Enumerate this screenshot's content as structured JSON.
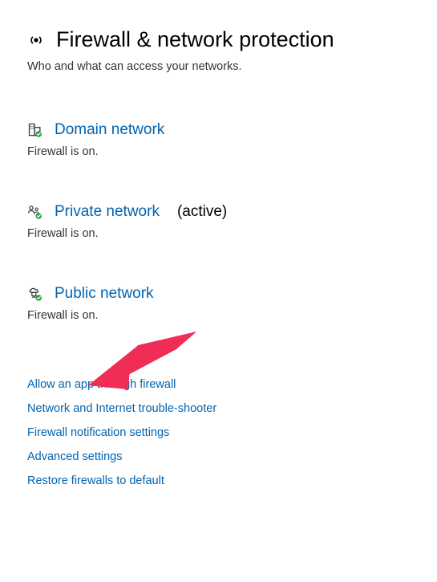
{
  "header": {
    "title": "Firewall & network protection",
    "subtitle": "Who and what can access your networks."
  },
  "networks": {
    "domain": {
      "title": "Domain network",
      "status": "Firewall is on."
    },
    "private": {
      "title": "Private network",
      "active_label": "(active)",
      "status": "Firewall is on."
    },
    "public": {
      "title": "Public network",
      "status": "Firewall is on."
    }
  },
  "links": {
    "allow_app": "Allow an app through firewall",
    "troubleshooter": "Network and Internet trouble-shooter",
    "notification": "Firewall notification settings",
    "advanced": "Advanced settings",
    "restore": "Restore firewalls to default"
  }
}
